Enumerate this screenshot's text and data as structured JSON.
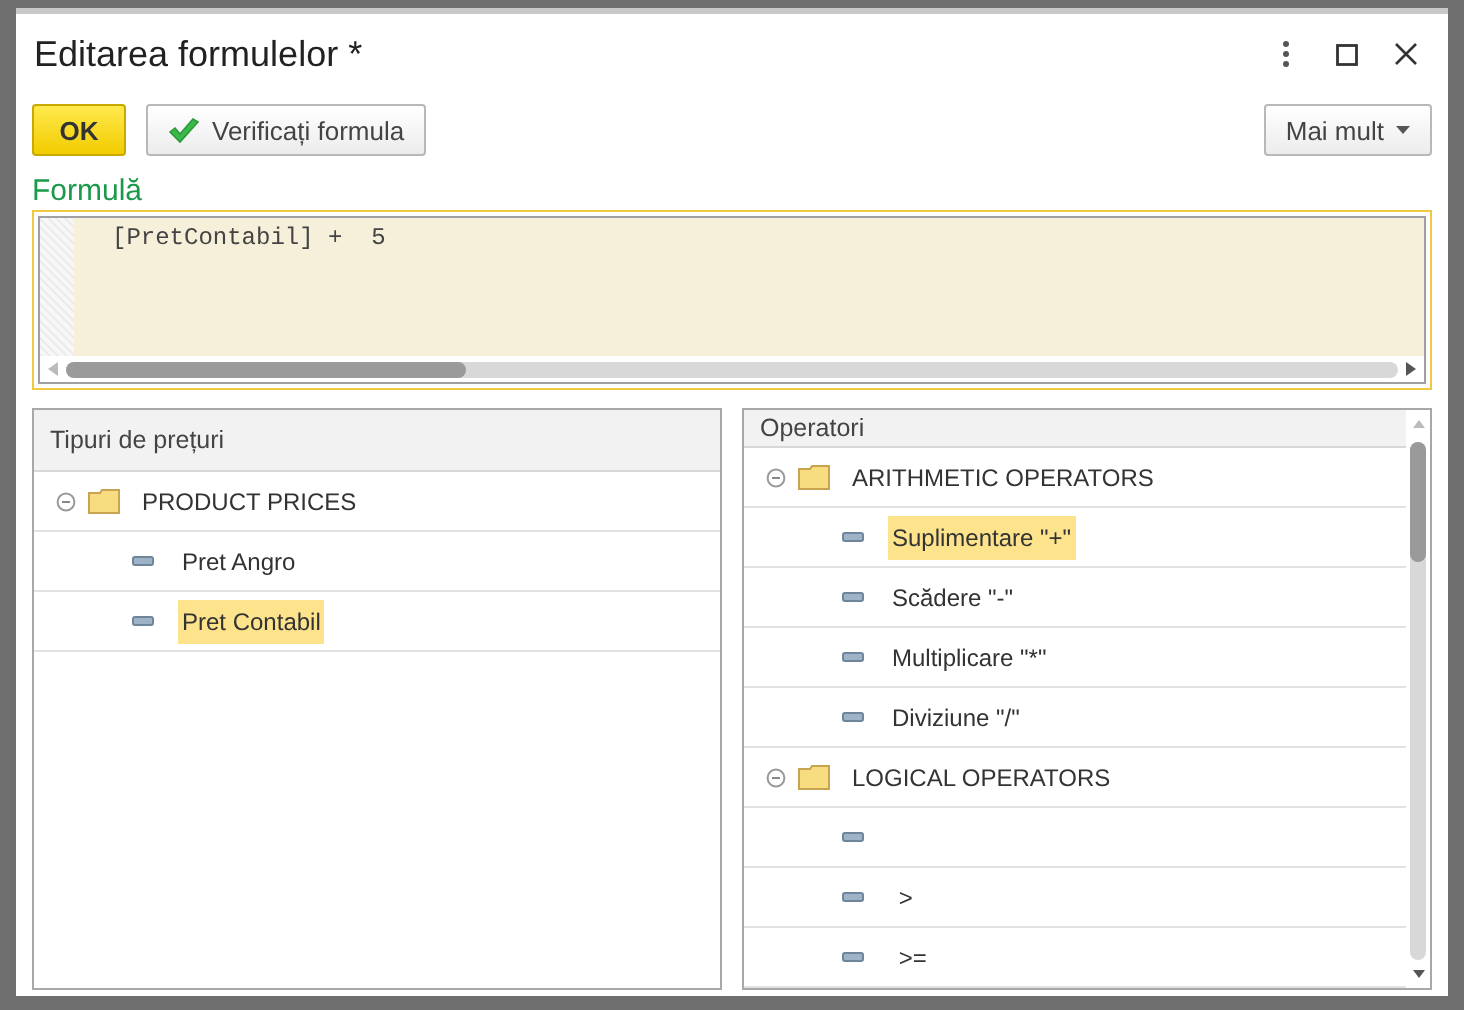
{
  "window": {
    "title": "Editarea formulelor *"
  },
  "toolbar": {
    "ok": "OK",
    "check": "Verificați formula",
    "more": "Mai mult"
  },
  "formula": {
    "label": "Formulă",
    "value": "[PretContabil] +  5"
  },
  "price_types": {
    "heading": "Tipuri de prețuri",
    "items": [
      {
        "label": "PRODUCT PRICES",
        "expanded": true,
        "selected": false,
        "children": [
          {
            "label": "Pret Angro",
            "selected": false
          },
          {
            "label": "Pret Contabil",
            "selected": true
          }
        ]
      }
    ]
  },
  "operators": {
    "heading": "Operatori",
    "items": [
      {
        "label": "ARITHMETIC OPERATORS",
        "expanded": true,
        "selected": false,
        "children": [
          {
            "label": "Suplimentare \"+\"",
            "selected": true
          },
          {
            "label": "Scădere \"-\"",
            "selected": false
          },
          {
            "label": "Multiplicare \"*\"",
            "selected": false
          },
          {
            "label": "Diviziune \"/\"",
            "selected": false
          }
        ]
      },
      {
        "label": "LOGICAL OPERATORS",
        "expanded": true,
        "selected": false,
        "children": [
          {
            "selected": false
          },
          {
            "label": " >",
            "selected": false
          },
          {
            "label": " >=",
            "selected": false
          }
        ]
      }
    ]
  }
}
